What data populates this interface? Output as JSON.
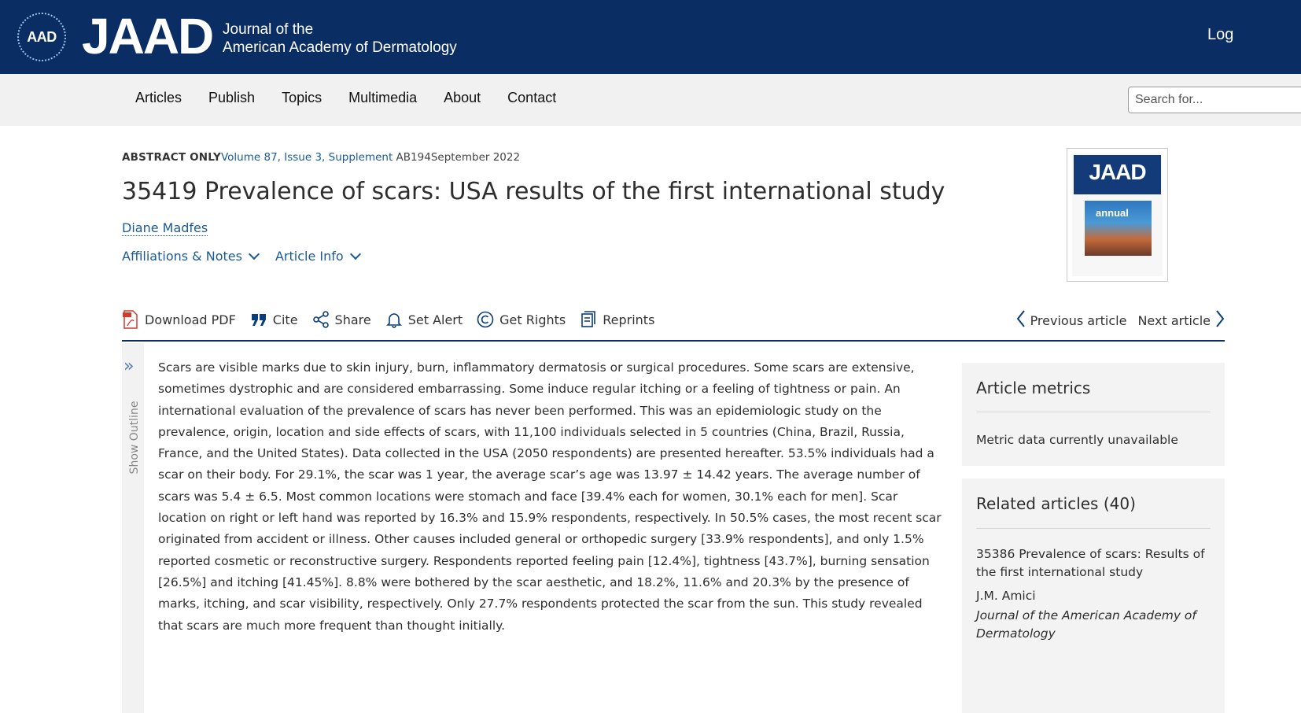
{
  "header": {
    "badge_text": "AAD",
    "brand_text": "JAAD",
    "brand_sub_line1": "Journal of the",
    "brand_sub_line2": "American Academy of Dermatology",
    "login_label": "Log"
  },
  "nav": {
    "items": [
      {
        "label": "Articles"
      },
      {
        "label": "Publish"
      },
      {
        "label": "Topics"
      },
      {
        "label": "Multimedia"
      },
      {
        "label": "About"
      },
      {
        "label": "Contact"
      }
    ],
    "search_placeholder": "Search for..."
  },
  "article": {
    "access_label": "ABSTRACT ONLY",
    "volume_link": "Volume 87, Issue 3, Supplement",
    "pages": "AB194",
    "date": "September 2022",
    "title": "35419 Prevalence of scars: USA results of the first international study",
    "author": "Diane Madfes",
    "affiliations_label": "Affiliations & Notes",
    "article_info_label": "Article Info",
    "cover_logo_text": "JAAD",
    "cover_band_text": "annual"
  },
  "toolbar": {
    "download_pdf": "Download PDF",
    "cite": "Cite",
    "share": "Share",
    "set_alert": "Set Alert",
    "get_rights": "Get Rights",
    "reprints": "Reprints",
    "previous_article": "Previous article",
    "next_article": "Next article"
  },
  "outline": {
    "label": "Show Outline"
  },
  "abstract": {
    "text": "Scars are visible marks due to skin injury, burn, inflammatory dermatosis or surgical procedures. Some scars are extensive, sometimes dystrophic and are considered embarrassing. Some induce regular itching or a feeling of tightness or pain. An international evaluation of the prevalence of scars has never been performed. This was an epidemiologic study on the prevalence, origin, location and side effects of scars, with 11,100 individuals selected in 5 countries (China, Brazil, Russia, France, and the United States). Data collected in the USA (2050 respondents) are presented hereafter. 53.5% individuals had a scar on their body. For 29.1%, the scar was 1 year, the average scar’s age was 13.97 ± 14.42 years. The average number of scars was 5.4 ± 6.5. Most common locations were stomach and face [39.4% each for women, 30.1% each for men]. Scar location on right or left hand was reported by 16.3% and 15.9% respondents, respectively. In 50.5% cases, the most recent scar originated from accident or illness. Other causes included general or orthopedic surgery [33.9% respondents], and only 1.5% reported cosmetic or reconstructive surgery. Respondents reported feeling pain [12.4%], tightness [43.7%], burning sensation [26.5%] and itching [41.45%]. 8.8% were bothered by the scar aesthetic, and 18.2%, 11.6% and 20.3% by the presence of marks, itching, and scar visibility, respectively. Only 27.7% respondents protected the scar from the sun. This study revealed that scars are much more frequent than thought initially."
  },
  "sidebar": {
    "metrics_title": "Article metrics",
    "metrics_text": "Metric data currently unavailable",
    "related_title": "Related articles (40)",
    "related_item_title": "35386 Prevalence of scars: Results of the first international study",
    "related_item_author": "J.M. Amici",
    "related_item_journal": "Journal of the American Academy of Dermatology"
  },
  "colors": {
    "header_bg": "#0a2d63",
    "link": "#1a5a96",
    "nav_bg": "#f1f1f1",
    "sidebar_bg": "#f3f3f3"
  }
}
